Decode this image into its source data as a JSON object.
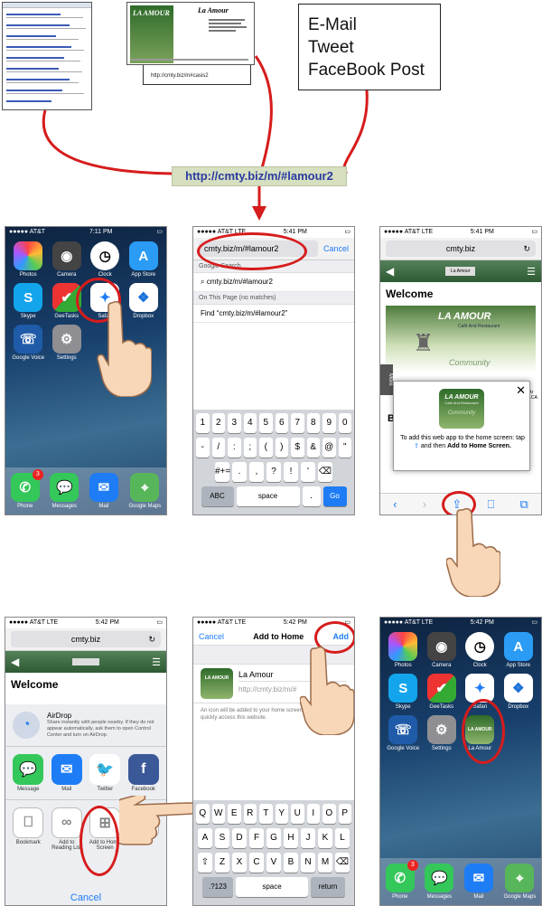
{
  "business_card": {
    "name": "La Amour",
    "logo_text": "LA AMOUR",
    "url": "http://cmty.biz/m#casis2"
  },
  "share_channels": [
    "E-Mail",
    "Tweet",
    "FaceBook Post"
  ],
  "url_banner": "http://cmty.biz/m/#lamour2",
  "home_screen": {
    "carrier": "●●●●● AT&T",
    "time": "7:11 PM",
    "apps": [
      "Photos",
      "Camera",
      "Clock",
      "App Store",
      "Skype",
      "GeeTasks",
      "Safari",
      "Dropbox",
      "Google Voice",
      "Settings"
    ],
    "dock": [
      "Phone",
      "Messages",
      "Mail",
      "Google Maps"
    ],
    "phone_badge": "3"
  },
  "safari_entry": {
    "carrier": "●●●●● AT&T",
    "network": "LTE",
    "time": "5:41 PM",
    "url_text": "cmty.biz/m/#lamour2",
    "cancel": "Cancel",
    "section_search": "Google Search",
    "suggestion": "cmty.biz/m/#lamour2",
    "section_page": "On This Page (no matches)",
    "find": "Find “cmty.biz/m/#lamour2”",
    "keys_row1": [
      "1",
      "2",
      "3",
      "4",
      "5",
      "6",
      "7",
      "8",
      "9",
      "0"
    ],
    "keys_row2": [
      "-",
      "/",
      ":",
      ";",
      "(",
      ")",
      "$",
      "&",
      "@",
      "\""
    ],
    "keys_row3": [
      "#+=",
      ".",
      ",",
      "?",
      "!",
      "'",
      "⌫"
    ],
    "key_abc": "ABC",
    "key_space": "space",
    "key_dot": ".",
    "key_go": "Go"
  },
  "webapp_page": {
    "carrier": "●●●●● AT&T",
    "network": "LTE",
    "time": "5:41 PM",
    "domain": "cmty.biz",
    "site_header": "La Amour",
    "welcome": "Welcome",
    "logo_text": "LA AMOUR",
    "logo_sub": "Café And Restaurant",
    "community": "Community",
    "more_tab": "More",
    "popup_logo": "LA AMOUR",
    "popup_sub": "Café And Restaurant",
    "popup_community": "Community",
    "popup_text": "To add this web app to the home screen: tap",
    "popup_text2": "and then",
    "popup_bold": "Add to Home Screen.",
    "side_text_1": "Ar",
    "side_text_2": "LCA",
    "b_letter": "B"
  },
  "share_sheet": {
    "carrier": "●●●●● AT&T",
    "network": "LTE",
    "time": "5:42 PM",
    "domain": "cmty.biz",
    "welcome": "Welcome",
    "airdrop_title": "AirDrop",
    "airdrop_text": "Share instantly with people nearby. If they do not appear automatically, ask them to open Control Center and turn on AirDrop.",
    "share_apps": [
      "Message",
      "Mail",
      "Twitter",
      "Facebook"
    ],
    "actions": [
      "Bookmark",
      "Add to Reading List",
      "Add to Home Screen",
      "Co"
    ],
    "cancel": "Cancel"
  },
  "add_to_home": {
    "carrier": "●●●●● AT&T",
    "network": "LTE",
    "time": "5:42 PM",
    "cancel": "Cancel",
    "title": "Add to Home",
    "add": "Add",
    "name_value": "La Amour",
    "url_value": "http://cmty.biz/m/#",
    "hint": "An icon will be added to your home screen so you can quickly access this website.",
    "keys_row1": [
      "Q",
      "W",
      "E",
      "R",
      "T",
      "Y",
      "U",
      "I",
      "O",
      "P"
    ],
    "keys_row2": [
      "A",
      "S",
      "D",
      "F",
      "G",
      "H",
      "J",
      "K",
      "L"
    ],
    "keys_row3": [
      "⇧",
      "Z",
      "X",
      "C",
      "V",
      "B",
      "N",
      "M",
      "⌫"
    ],
    "key_123": ".?123",
    "key_space": "space",
    "key_return": "return"
  },
  "final_home": {
    "carrier": "●●●●● AT&T",
    "network": "LTE",
    "time": "5:42 PM",
    "apps": [
      "Photos",
      "Camera",
      "Clock",
      "App Store",
      "Skype",
      "GeeTasks",
      "Safari",
      "Dropbox",
      "Google Voice",
      "Settings",
      "La Amour"
    ],
    "dock": [
      "Phone",
      "Messages",
      "Mail",
      "Google Maps"
    ],
    "phone_badge": "3"
  },
  "colors": {
    "accent_red": "#d61c1c",
    "ios_blue": "#1e7cf5",
    "site_green": "#2d5a33",
    "banner": "#d6dfbf"
  }
}
